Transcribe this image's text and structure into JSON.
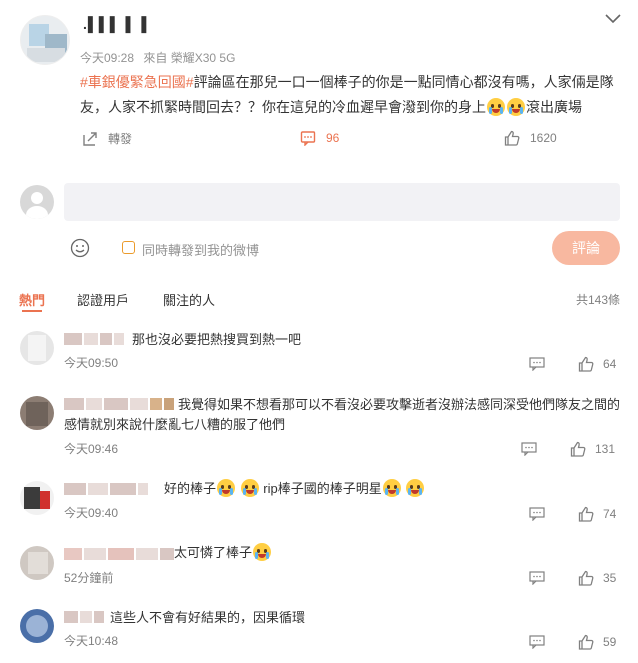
{
  "post": {
    "username": ".▌▌▌ ▌ ▌",
    "time": "今天09:28",
    "source": "來自 榮耀X30 5G",
    "hashtag": "#車銀優緊急回國#",
    "text_before_emoji": "評論區在那兒一口一個棒子的你是一點同情心都沒有嗎，人家倆是隊友，人家不抓緊時間回去？？你在這兒的冷血遲早會潑到你的身上",
    "text_after_emoji": "滾出廣場",
    "actions": {
      "repost": "轉發",
      "comments": "96",
      "likes": "1620"
    }
  },
  "composer": {
    "placeholder": "",
    "checkbox_label": "同時轉發到我的微博",
    "submit_label": "評論"
  },
  "tabs": {
    "hot": "熱門",
    "verified": "認證用戶",
    "following": "關注的人",
    "total": "共143條"
  },
  "comments": [
    {
      "text": "那也沒必要把熱搜買到熱一吧",
      "time": "今天09:50",
      "likes": "64"
    },
    {
      "text": "我覺得如果不想看那可以不看沒必要攻擊逝者沒辦法感同深受他們隊友之間的感情就別來說什麼亂七八糟的服了他們",
      "time": "今天09:46",
      "likes": "131"
    },
    {
      "text_a": "好的棒子",
      "text_b": "rip棒子國的棒子明星",
      "time": "今天09:40",
      "likes": "74"
    },
    {
      "text": "太可憐了棒子",
      "time": "52分鐘前",
      "likes": "35"
    },
    {
      "text": "這些人不會有好結果的，因果循環",
      "time": "今天10:48",
      "likes": "59"
    }
  ],
  "colors": {
    "accent": "#eb7350",
    "submit_bg": "#f8b8a0",
    "muted": "#939393"
  }
}
